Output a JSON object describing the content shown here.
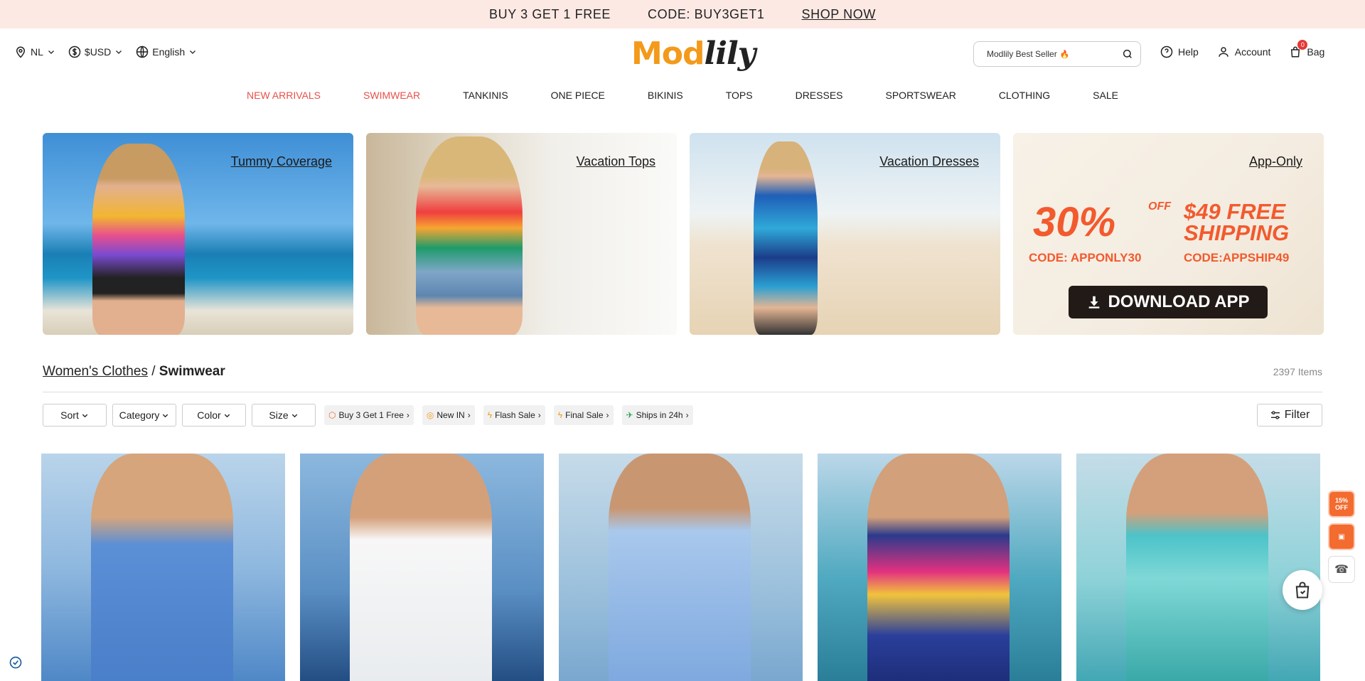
{
  "promo": {
    "offer": "BUY 3 GET 1 FREE",
    "code": "CODE: BUY3GET1",
    "cta": "SHOP NOW"
  },
  "header": {
    "region": "NL",
    "currency": "$USD",
    "language": "English",
    "logo_part1": "Mod",
    "logo_part2": "lily",
    "search_placeholder": "Modlily Best Seller",
    "help": "Help",
    "account": "Account",
    "bag": "Bag",
    "bag_count": "0"
  },
  "nav": [
    {
      "label": "NEW ARRIVALS",
      "highlight": true
    },
    {
      "label": "SWIMWEAR",
      "highlight": true
    },
    {
      "label": "TANKINIS",
      "highlight": false
    },
    {
      "label": "ONE PIECE",
      "highlight": false
    },
    {
      "label": "BIKINIS",
      "highlight": false
    },
    {
      "label": "TOPS",
      "highlight": false
    },
    {
      "label": "DRESSES",
      "highlight": false
    },
    {
      "label": "SPORTSWEAR",
      "highlight": false
    },
    {
      "label": "CLOTHING",
      "highlight": false
    },
    {
      "label": "SALE",
      "highlight": false
    }
  ],
  "banners": [
    {
      "label": "Tummy Coverage"
    },
    {
      "label": "Vacation Tops"
    },
    {
      "label": "Vacation Dresses"
    },
    {
      "label": "App-Only"
    }
  ],
  "app_banner": {
    "percent": "30%",
    "off": "OFF",
    "free_line1": "$49 FREE",
    "free_line2": "SHIPPING",
    "code1": "CODE: APPONLY30",
    "code2": "CODE:APPSHIP49",
    "download": "DOWNLOAD APP"
  },
  "breadcrumb": {
    "parent": "Women's Clothes",
    "separator": "/",
    "current": "Swimwear"
  },
  "item_count": "2397 Items",
  "filters": {
    "sort": "Sort",
    "category": "Category",
    "color": "Color",
    "size": "Size",
    "chips": [
      {
        "label": "Buy 3 Get 1 Free",
        "icon": "tag-icon"
      },
      {
        "label": "New IN",
        "icon": "new-icon"
      },
      {
        "label": "Flash Sale",
        "icon": "lightning-icon"
      },
      {
        "label": "Final Sale",
        "icon": "lightning-icon"
      },
      {
        "label": "Ships in 24h",
        "icon": "plane-icon"
      }
    ],
    "filter_button": "Filter"
  },
  "side_badges": {
    "discount": "15% OFF"
  },
  "colors": {
    "accent_red": "#e8504a",
    "logo_orange": "#f39a1a",
    "promo_bg": "#fde9e4",
    "app_orange": "#f25a2e"
  }
}
